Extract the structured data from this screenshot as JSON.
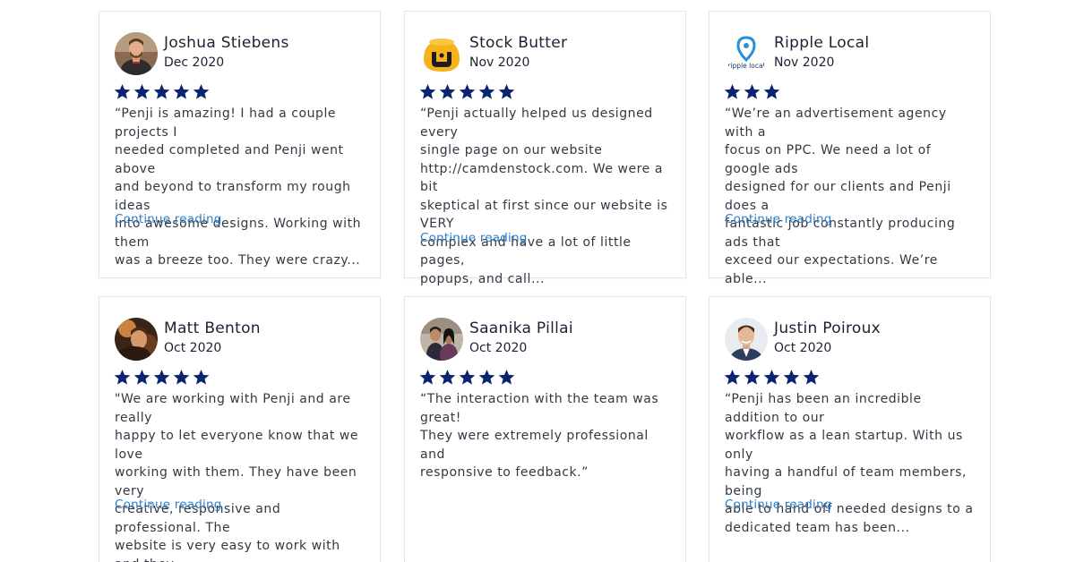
{
  "colors": {
    "star": "#0a2472",
    "link": "#2c7fc9",
    "text": "#333842",
    "name": "#1a2233",
    "card_border": "#e4e4e4"
  },
  "reviews": [
    {
      "name": "Joshua Stiebens",
      "date": "Dec 2020",
      "rating": 5,
      "avatar_icon": "person-photo-avatar",
      "text": "“Penji is amazing! I had a couple projects I\nneeded completed and Penji went above\nand beyond to transform my rough ideas\ninto awesome designs. Working with them\nwas a breeze too. They were crazy...",
      "link_label": "Continue reading"
    },
    {
      "name": "Stock Butter",
      "date": "Nov 2020",
      "rating": 5,
      "avatar_icon": "stock-butter-logo",
      "text": "“Penji actually helped us designed every\nsingle page on our website\nhttp://camdenstock.com. We were a bit\nskeptical at first since our website is VERY\ncomplex and have a lot of little pages,\npopups, and call...",
      "link_label": "Continue reading"
    },
    {
      "name": "Ripple Local",
      "date": "Nov 2020",
      "rating": 3,
      "avatar_icon": "ripple-local-logo",
      "avatar_text": "ripple local",
      "text": "“We’re an advertisement agency with a\nfocus on PPC. We need a lot of google ads\ndesigned for our clients and Penji does a\nfantastic job constantly producing ads that\nexceed our expectations. We’re able...",
      "link_label": "Continue reading"
    },
    {
      "name": "Matt Benton",
      "date": "Oct 2020",
      "rating": 5,
      "avatar_icon": "person-photo-avatar",
      "text": "\"We are working with Penji and are really\nhappy to let everyone know that we love\nworking with them. They have been very\ncreative, responsive and professional. The\nwebsite is very easy to work with and they...",
      "link_label": "Continue reading"
    },
    {
      "name": "Saanika Pillai",
      "date": "Oct 2020",
      "rating": 5,
      "avatar_icon": "person-photo-avatar",
      "text": "“The interaction with the team was great!\nThey were extremely professional and\nresponsive to feedback.”",
      "link_label": ""
    },
    {
      "name": "Justin Poiroux",
      "date": "Oct 2020",
      "rating": 5,
      "avatar_icon": "person-photo-avatar",
      "text": "“Penji has been an incredible addition to our\nworkflow as a lean startup. With us only\nhaving a handful of team members, being\nable to hand off needed designs to a\ndedicated team has been...",
      "link_label": "Continue reading"
    }
  ]
}
